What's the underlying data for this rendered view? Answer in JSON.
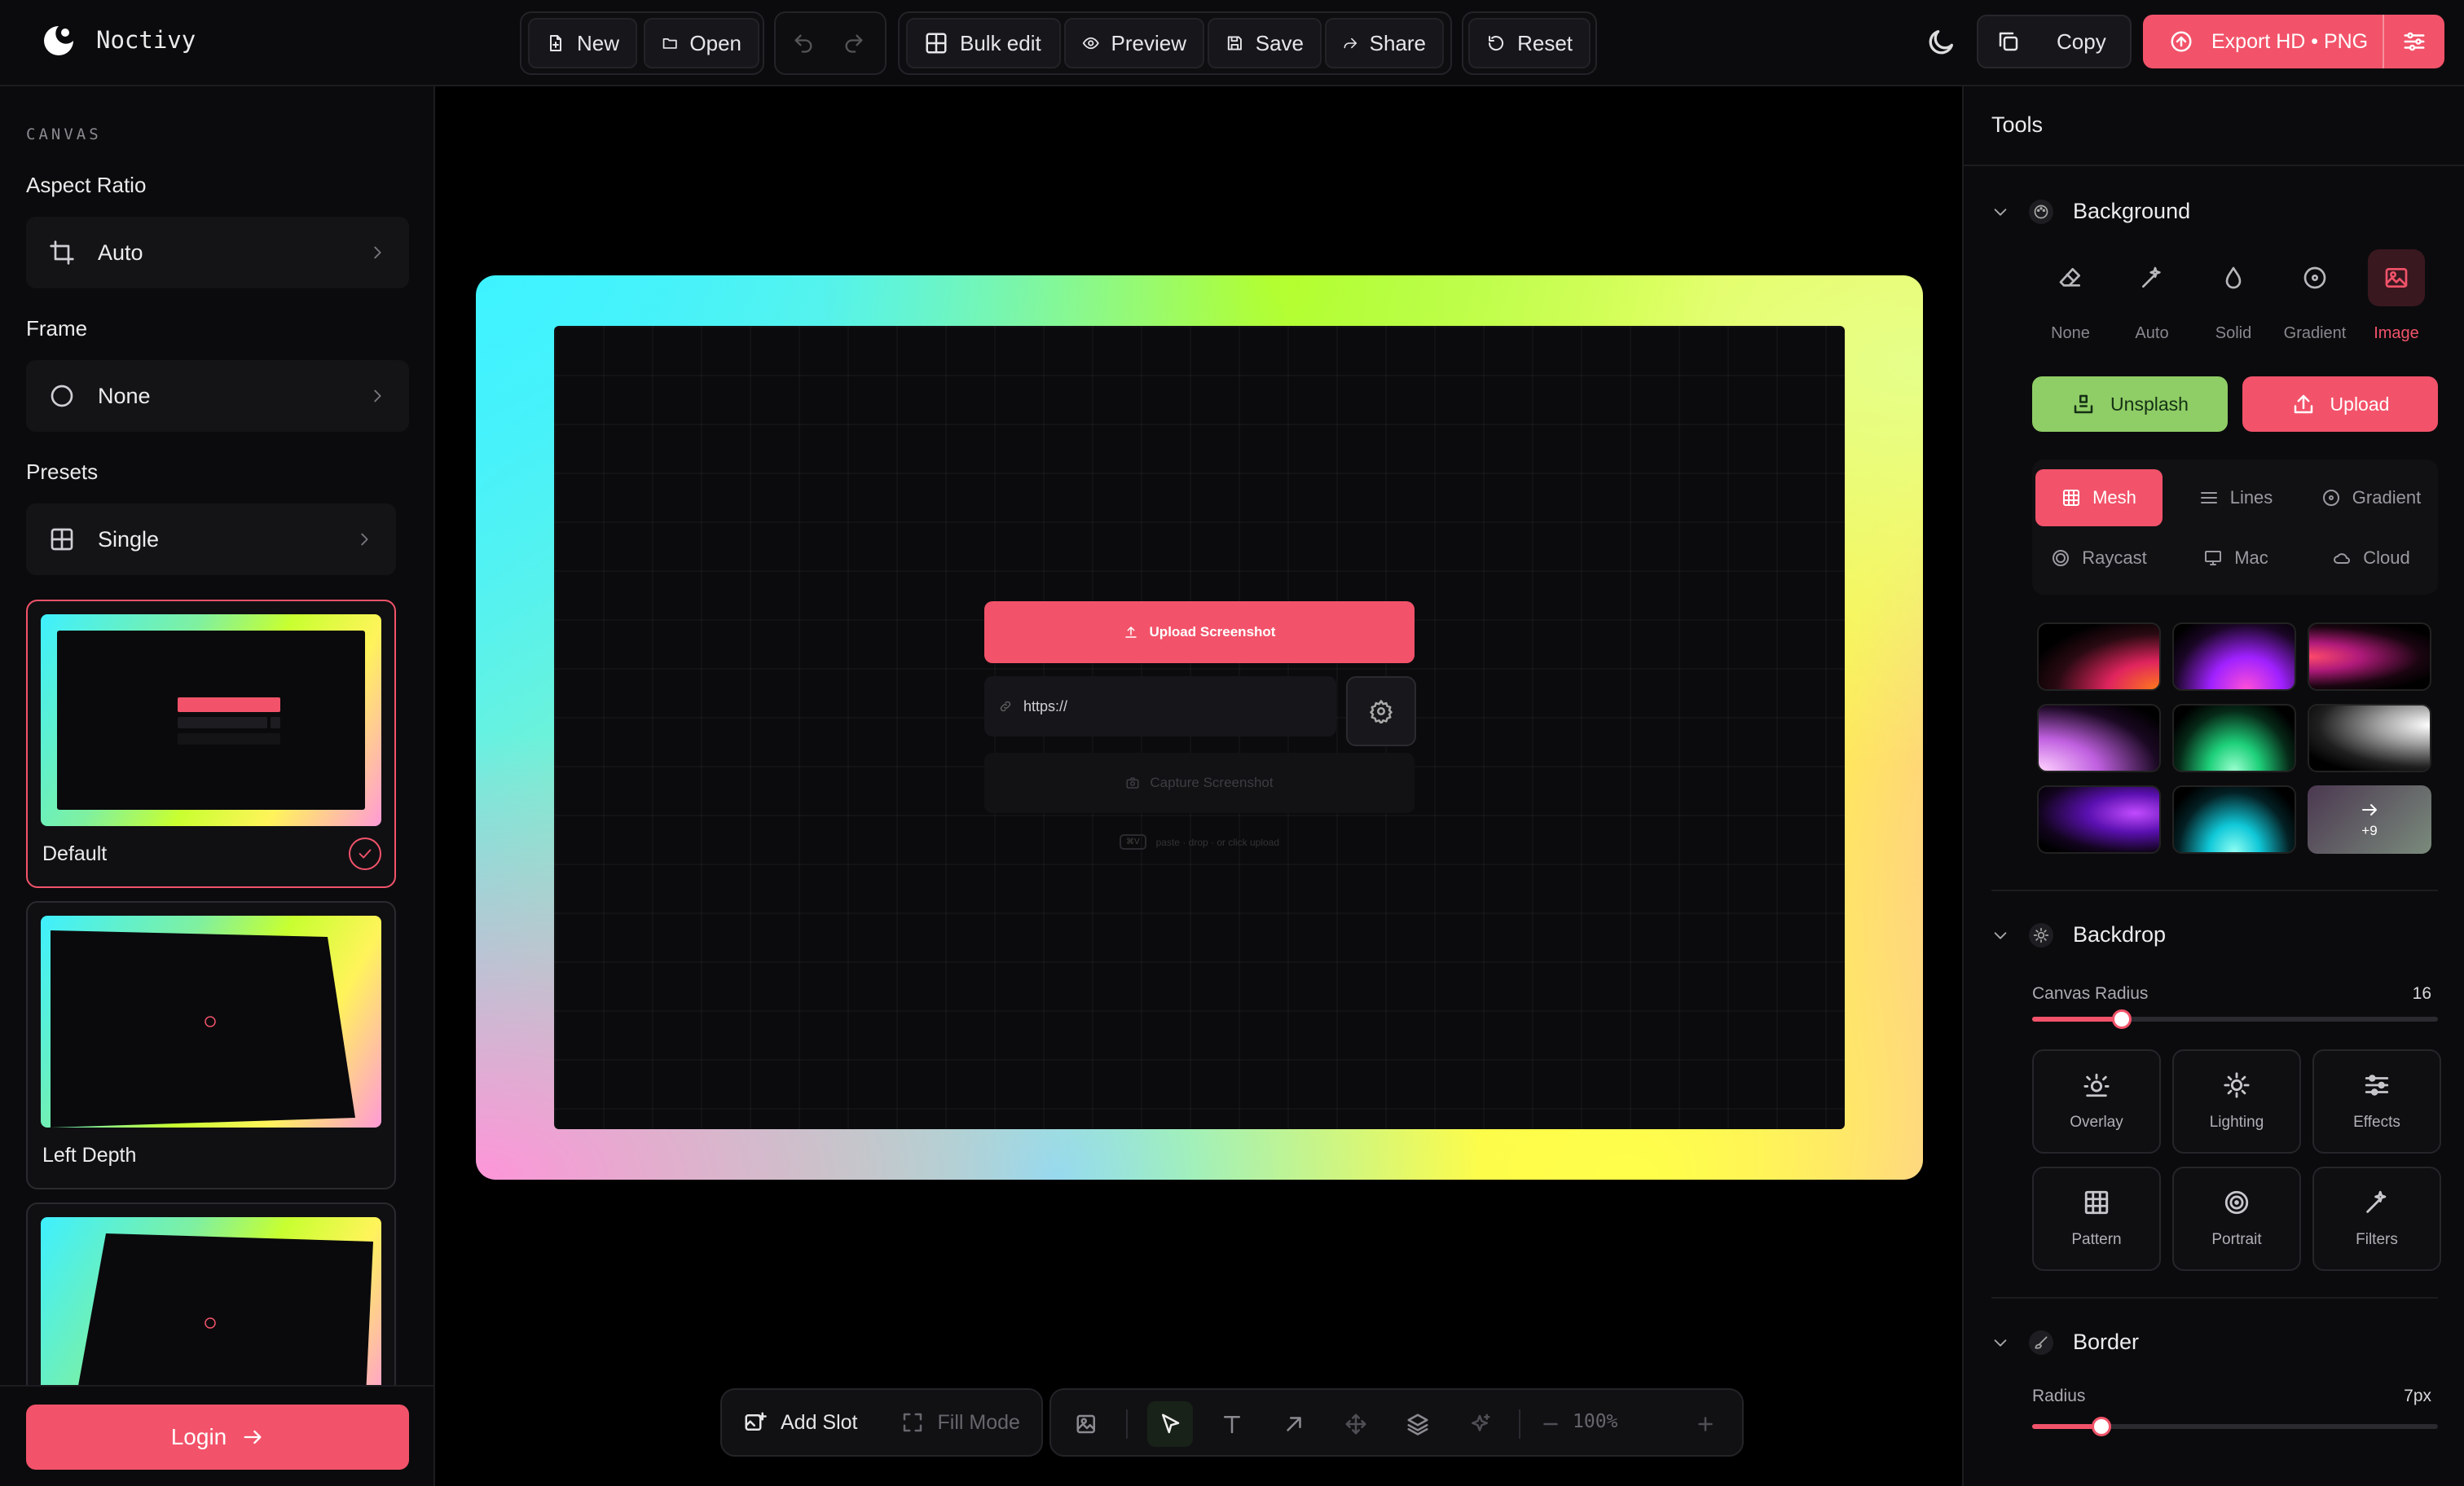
{
  "app": {
    "name": "Noctivy"
  },
  "toolbar": {
    "new": "New",
    "open": "Open",
    "bulk_edit": "Bulk edit",
    "preview": "Preview",
    "save": "Save",
    "share": "Share",
    "reset": "Reset",
    "copy": "Copy",
    "export": "Export HD • PNG"
  },
  "left": {
    "section": "CANVAS",
    "aspect_label": "Aspect Ratio",
    "aspect_value": "Auto",
    "frame_label": "Frame",
    "frame_value": "None",
    "presets_label": "Presets",
    "presets_value": "Single",
    "presets": [
      "Default",
      "Left Depth"
    ],
    "selected_preset": "Default",
    "login": "Login"
  },
  "canvas": {
    "upload": "Upload Screenshot",
    "url_placeholder": "https://",
    "capture": "Capture Screenshot",
    "hint_key": "⌘V",
    "hint": "paste · drop · or click upload"
  },
  "bottom": {
    "add_slot": "Add Slot",
    "fill_mode": "Fill Mode",
    "zoom": "100%",
    "active_tool": "select"
  },
  "right": {
    "title": "Tools",
    "background": {
      "title": "Background",
      "types": [
        "None",
        "Auto",
        "Solid",
        "Gradient",
        "Image"
      ],
      "active_type": "Image",
      "unsplash": "Unsplash",
      "upload": "Upload",
      "categories": [
        "Mesh",
        "Lines",
        "Gradient",
        "Raycast",
        "Mac",
        "Cloud"
      ],
      "active_category": "Mesh",
      "more_count": "+9"
    },
    "backdrop": {
      "title": "Backdrop",
      "radius_label": "Canvas Radius",
      "radius_value": "16",
      "radius_fraction": 0.22,
      "effects": [
        "Overlay",
        "Lighting",
        "Effects",
        "Pattern",
        "Portrait",
        "Filters"
      ]
    },
    "border": {
      "title": "Border",
      "radius_label": "Radius",
      "radius_value": "7px",
      "radius_fraction": 0.17
    }
  },
  "colors": {
    "accent": "#f2536a",
    "unsplash": "#8fcd66",
    "bg": "#0b0b0d"
  }
}
